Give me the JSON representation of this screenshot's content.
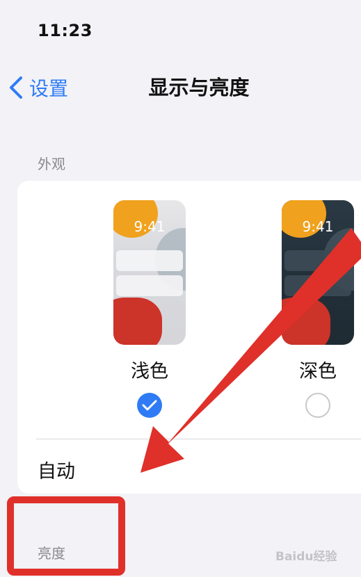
{
  "status_bar": {
    "time": "11:23"
  },
  "nav": {
    "back_label": "设置",
    "title": "显示与亮度"
  },
  "appearance": {
    "section_title": "外观",
    "light": {
      "preview_time": "9:41",
      "label": "浅色",
      "selected": true
    },
    "dark": {
      "preview_time": "9:41",
      "label": "深色",
      "selected": false
    },
    "auto_label": "自动"
  },
  "brightness": {
    "section_title": "亮度"
  },
  "watermark": "Baidu经验",
  "colors": {
    "accent": "#2f7bf5",
    "annotation": "#e0302a",
    "background": "#f2f2f7"
  }
}
